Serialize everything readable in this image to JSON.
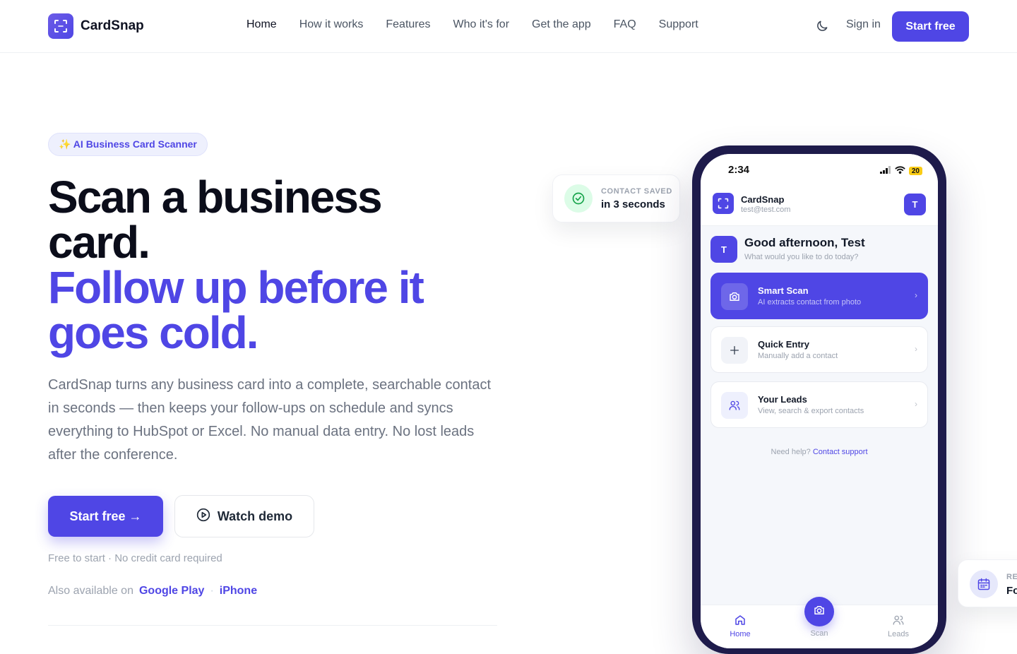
{
  "nav": {
    "brand": "CardSnap",
    "links": [
      "Home",
      "How it works",
      "Features",
      "Who it's for",
      "Get the app",
      "FAQ",
      "Support"
    ],
    "active": "Home",
    "theme_icon": "moon-icon",
    "sign_in": "Sign in",
    "start_free": "Start free"
  },
  "hero": {
    "badge": "✨ AI Business Card Scanner",
    "headline_1": "Scan a business card.",
    "headline_2": "Follow up before it goes cold.",
    "paragraph": "CardSnap turns any business card into a complete, searchable contact in seconds — then keeps your follow-ups on schedule and syncs everything to HubSpot or Excel. No manual data entry. No lost leads after the conference.",
    "cta_primary": "Start free →",
    "cta_secondary": "Watch demo",
    "note": "Free to start · No credit card required",
    "available_label": "Also available on",
    "store_1": "Google Play",
    "separator": "·",
    "store_2": "iPhone"
  },
  "toast": {
    "label": "CONTACT SAVED",
    "value": "in 3 seconds",
    "icon": "check-circle-icon"
  },
  "phone": {
    "time": "2:34",
    "battery": "20",
    "app_name": "CardSnap",
    "email": "test@test.com",
    "avatar": "T",
    "greeting": "Good afternoon, Test",
    "subgreeting": "What would you like to do today?",
    "actions": [
      {
        "title": "Smart Scan",
        "subtitle": "AI extracts contact from photo",
        "icon": "camera-icon"
      },
      {
        "title": "Quick Entry",
        "subtitle": "Manually add a contact",
        "icon": "plus-icon"
      },
      {
        "title": "Your Leads",
        "subtitle": "View, search & export contacts",
        "icon": "users-icon"
      }
    ],
    "help_text": "Need help?",
    "help_link": "Contact support",
    "tabs": [
      "Home",
      "Scan",
      "Leads"
    ]
  },
  "reminder": {
    "label": "RE",
    "value": "Fo",
    "icon": "calendar-icon"
  },
  "colors": {
    "brand": "#4f46e5",
    "success": "#16a34a",
    "phone_frame": "#1e1b4b"
  }
}
